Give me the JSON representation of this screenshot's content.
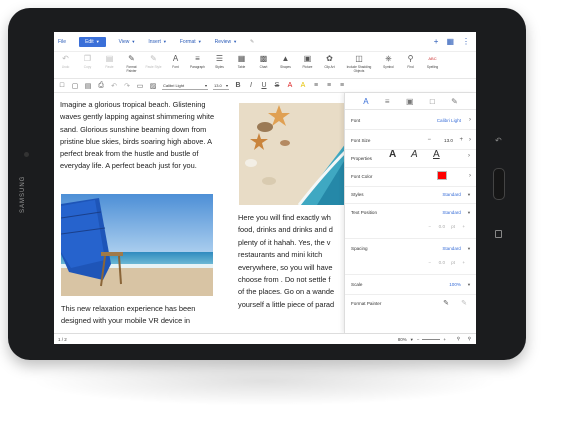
{
  "device": {
    "brand": "SAMSUNG"
  },
  "menu": {
    "items": [
      {
        "label": "File",
        "active": false
      },
      {
        "label": "Edit",
        "active": true
      },
      {
        "label": "View",
        "active": false
      },
      {
        "label": "Insert",
        "active": false
      },
      {
        "label": "Format",
        "active": false
      },
      {
        "label": "Review",
        "active": false
      }
    ]
  },
  "ribbon": {
    "items": [
      {
        "label": "Undo",
        "icon": "undo-icon",
        "disabled": true
      },
      {
        "label": "Copy",
        "icon": "copy-icon",
        "disabled": true
      },
      {
        "label": "Paste",
        "icon": "paste-icon",
        "disabled": true
      },
      {
        "label": "Format Painter",
        "icon": "format-painter-icon",
        "disabled": false
      },
      {
        "label": "Paste Style",
        "icon": "paste-style-icon",
        "disabled": true
      },
      {
        "label": "Font",
        "icon": "font-icon",
        "disabled": false
      },
      {
        "label": "Paragraph",
        "icon": "paragraph-icon",
        "disabled": false
      },
      {
        "label": "Styles",
        "icon": "styles-icon",
        "disabled": false
      },
      {
        "label": "Table",
        "icon": "table-icon",
        "disabled": false
      },
      {
        "label": "Chart",
        "icon": "chart-icon",
        "disabled": false
      },
      {
        "label": "Shapes",
        "icon": "shapes-icon",
        "disabled": false
      },
      {
        "label": "Picture",
        "icon": "picture-icon",
        "disabled": false
      },
      {
        "label": "Clip Art",
        "icon": "clip-art-icon",
        "disabled": false
      },
      {
        "label": "Include Shadding Objects",
        "icon": "include-objects-icon",
        "disabled": false
      },
      {
        "label": "Symbol",
        "icon": "symbol-icon",
        "disabled": false
      },
      {
        "label": "Find",
        "icon": "find-icon",
        "disabled": false
      },
      {
        "label": "Spelling",
        "icon": "spelling-icon",
        "disabled": false
      }
    ]
  },
  "formatbar": {
    "font": "Calibri Light",
    "size": "13.0"
  },
  "document": {
    "para1": "Imagine a glorious tropical beach. Glistening waves gently lapping against shimmering white sand. Glorious sunshine beaming down from pristine blue skies, birds soaring high above. A perfect break from the hustle and bustle of everyday life. A perfect beach just for you.",
    "para2": "This new relaxation experience has been designed with your mobile VR device in",
    "para3_lines": [
      "Here you will find exactly wh",
      "food, drinks and drinks and d",
      "plenty of it hahah. Yes, the v",
      "restaurants and mini kitch",
      "everywhere, so you will have",
      "choose from . Do not settle f",
      "of the places. Go on a wande",
      "yourself a little piece of parad"
    ]
  },
  "panel": {
    "tabs": [
      "text-icon",
      "paragraph-align-icon",
      "layout-icon",
      "page-icon",
      "pencil-icon"
    ],
    "font_label": "Font",
    "font_value": "Calibri Light",
    "size_label": "Font Size",
    "size_value": "13.0",
    "properties_label": "Properties",
    "color_label": "Font Color",
    "font_color": "#ff0000",
    "styles_label": "Styles",
    "styles_value": "Standard",
    "textpos_label": "Text Position",
    "textpos_value": "Standard",
    "textpos_num": "0.0",
    "textpos_unit": "pt",
    "spacing_label": "Spacing",
    "spacing_value": "Standard",
    "spacing_num": "0.0",
    "spacing_unit": "pt",
    "scale_label": "Scale",
    "scale_value": "100%",
    "painter_label": "Format Painter"
  },
  "status": {
    "page": "1 / 2",
    "zoom": "80%"
  }
}
